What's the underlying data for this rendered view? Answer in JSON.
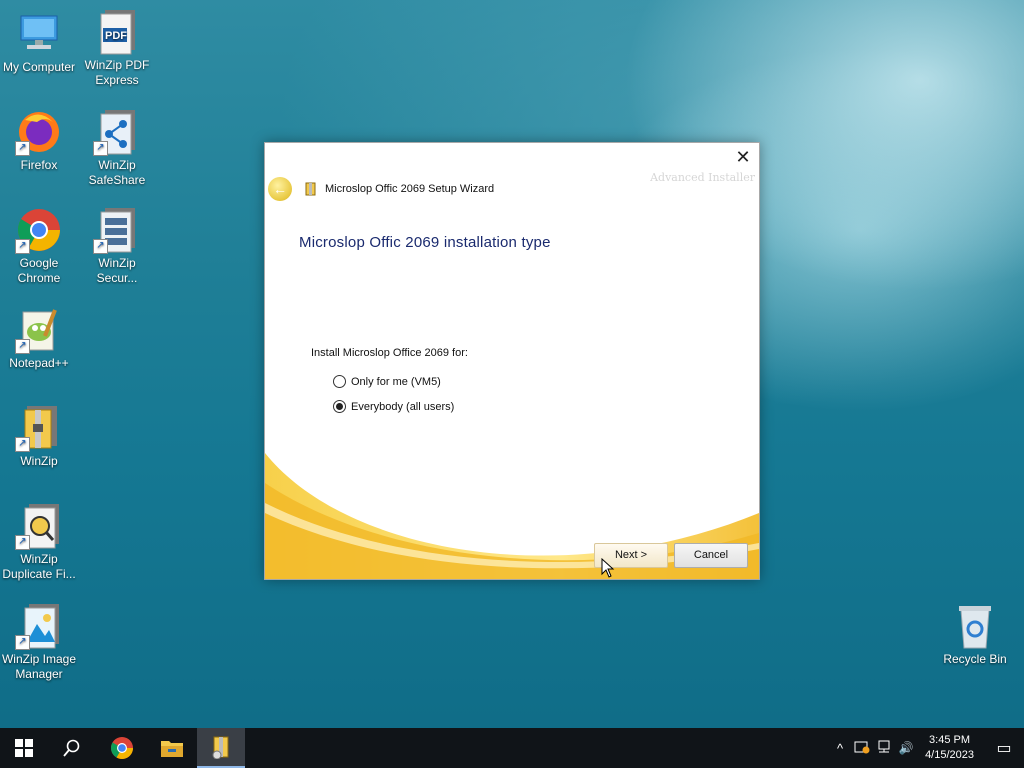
{
  "desktop": {
    "icons": [
      {
        "label": "My Computer"
      },
      {
        "label": "WinZip PDF Express"
      },
      {
        "label": "Firefox"
      },
      {
        "label": "WinZip SafeShare"
      },
      {
        "label": "Google Chrome"
      },
      {
        "label": "WinZip Secur..."
      },
      {
        "label": "Notepad++"
      },
      {
        "label": "WinZip"
      },
      {
        "label": "WinZip Duplicate Fi..."
      },
      {
        "label": "WinZip Image Manager"
      },
      {
        "label": "Recycle Bin"
      }
    ],
    "pdf_glyph": "PDF"
  },
  "dialog": {
    "close_glyph": "✕",
    "brand_text": "Advanced Installer",
    "back_glyph": "←",
    "wizard_title": "Microslop Offic 2069 Setup Wizard",
    "heading": "Microslop Offic 2069 installation type",
    "prompt": "Install Microslop Office 2069 for:",
    "options": [
      {
        "label": "Only for me (VM5)",
        "selected": false
      },
      {
        "label": "Everybody (all users)",
        "selected": true
      }
    ],
    "next_label": "Next >",
    "cancel_label": "Cancel"
  },
  "taskbar": {
    "time": "3:45 PM",
    "date": "4/15/2023",
    "tray_chevron": "^",
    "volume_glyph": "🔊",
    "notification_glyph": "▭"
  }
}
